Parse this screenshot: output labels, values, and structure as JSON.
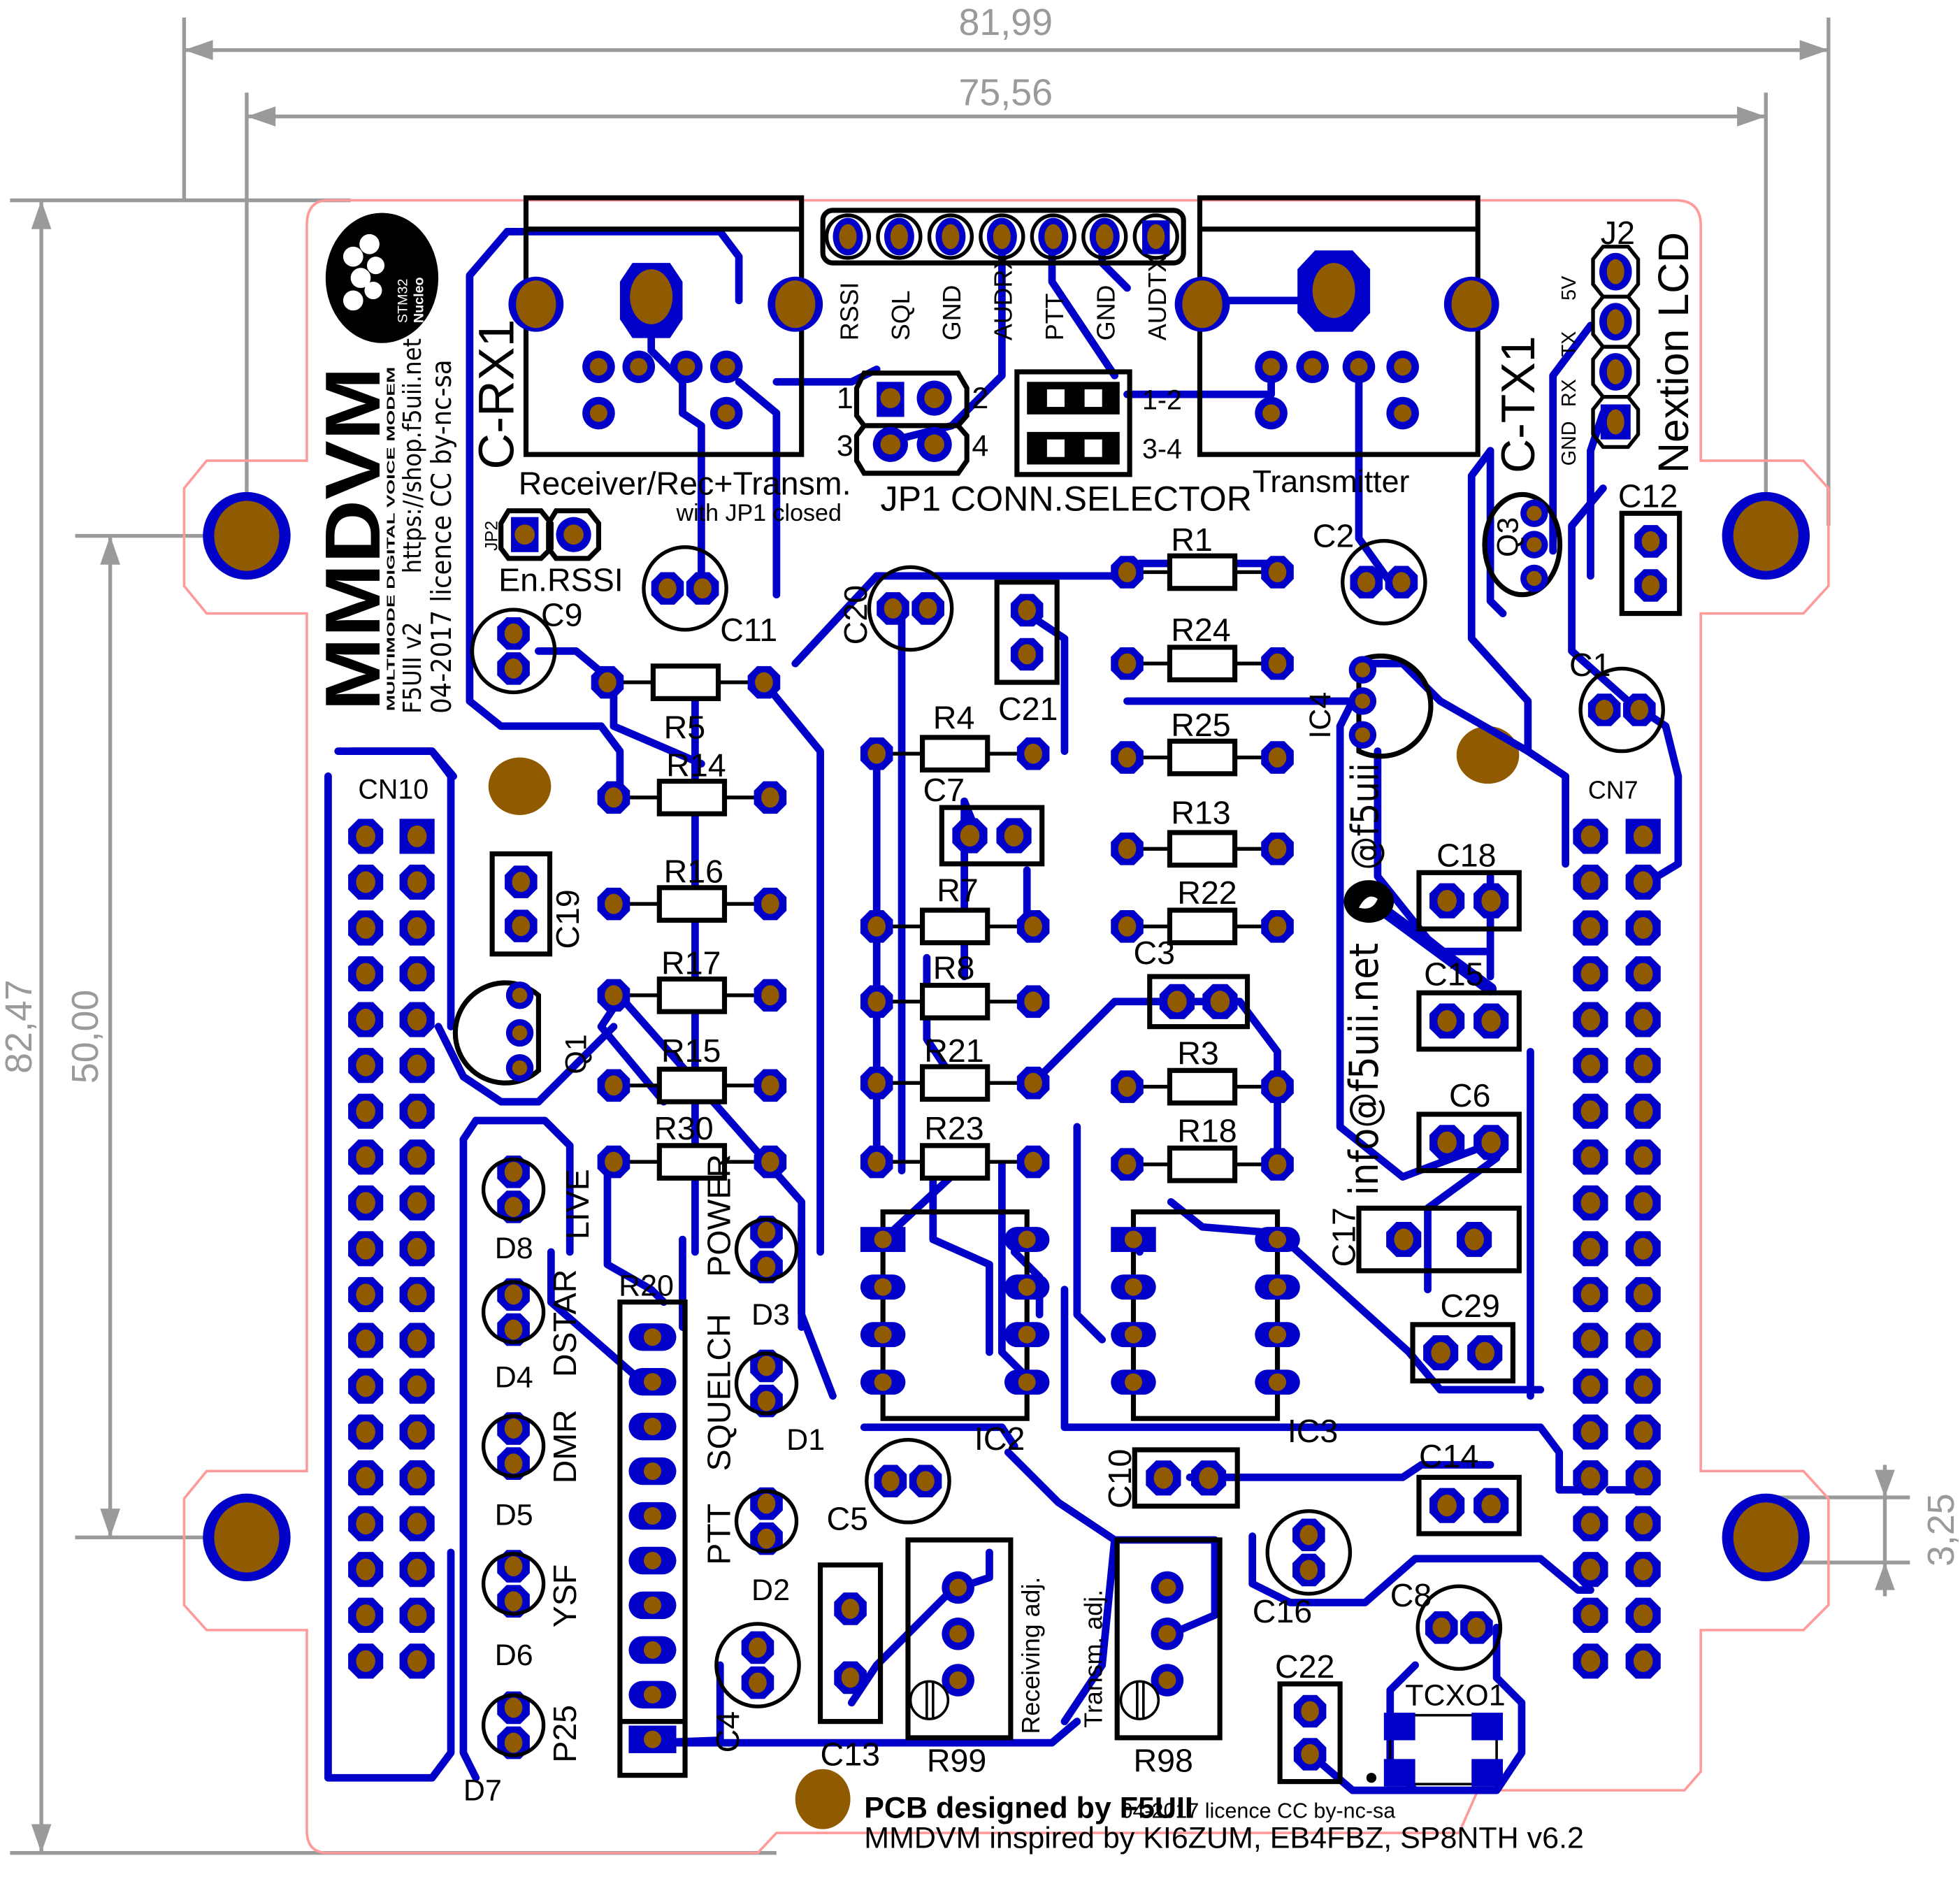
{
  "dimensions": {
    "overall_width": "81,99",
    "inner_width": "75,56",
    "overall_height": "82,47",
    "hole_spacing": "50,00",
    "hole_offset": "3,25"
  },
  "logo": {
    "brand": "MMDVM",
    "tagline": "MULTIMODE DIGITAL VOICE MODEM",
    "version": "F5UII v2",
    "url": "https://shop.f5uii.net",
    "license": "04-2017 licence CC by-nc-sa",
    "nucleo_badge_line1": "STM32",
    "nucleo_badge_line2": "Nucleo"
  },
  "connectors": {
    "crx1": {
      "ref": "C-RX1",
      "label": "Receiver/Rec+Transm.",
      "note": "with JP1 closed"
    },
    "ctx1": {
      "ref": "C-TX1",
      "label": "Transmitter"
    },
    "header_pins": [
      "RSSI",
      "SQL",
      "GND",
      "AUDRX",
      "PTT",
      "GND",
      "AUDTX"
    ],
    "jp1": {
      "label": "JP1 CONN.SELECTOR",
      "pins": [
        "1",
        "2",
        "3",
        "4"
      ],
      "jumpers": [
        "1-2",
        "3-4"
      ]
    },
    "jp2": {
      "ref": "JP2",
      "label": "En.RSSI"
    },
    "j2": {
      "ref": "J2",
      "title": "Nextion LCD",
      "pins": [
        "5V",
        "TX",
        "RX",
        "GND"
      ]
    },
    "cn10": "CN10",
    "cn7": "CN7"
  },
  "components": {
    "resistors": [
      "R1",
      "R24",
      "R25",
      "R13",
      "R22",
      "R3",
      "R18",
      "R4",
      "R7",
      "R8",
      "R21",
      "R23",
      "R5",
      "R14",
      "R16",
      "R17",
      "R15",
      "R30",
      "R20"
    ],
    "capacitors": [
      "C1",
      "C2",
      "C3",
      "C4",
      "C5",
      "C6",
      "C7",
      "C8",
      "C9",
      "C10",
      "C11",
      "C12",
      "C13",
      "C14",
      "C15",
      "C16",
      "C17",
      "C18",
      "C19",
      "C20",
      "C21",
      "C22",
      "C29"
    ],
    "transistors": [
      "Q1",
      "Q3"
    ],
    "ics": [
      "IC2",
      "IC3",
      "IC4"
    ],
    "leds": [
      {
        "ref": "D8",
        "label": "LIVE"
      },
      {
        "ref": "D4",
        "label": "DSTAR"
      },
      {
        "ref": "D5",
        "label": "DMR"
      },
      {
        "ref": "D6",
        "label": "YSF"
      },
      {
        "ref": "D7",
        "label": "P25"
      },
      {
        "ref": "D3",
        "label": "POWER"
      },
      {
        "ref": "D1",
        "label": "SQUELCH"
      },
      {
        "ref": "D2",
        "label": "PTT"
      }
    ],
    "trimmers": [
      {
        "ref": "R99",
        "label": "Receiving adj."
      },
      {
        "ref": "R98",
        "label": "Transm. adj."
      }
    ],
    "tcxo": "TCXO1"
  },
  "contact": "info@f5uii.net",
  "twitter": "@f5uii",
  "footer": {
    "line1_main": "PCB designed by F5UII",
    "line1_small": "04-2017 licence CC by-nc-sa",
    "line2": "MMDVM inspired by KI6ZUM, EB4FBZ, SP8NTH v6.2"
  },
  "colors": {
    "copper": "#0000c8",
    "drill": "#8f5a00",
    "silkscreen": "#000000",
    "board_edge": "#ff9a9a",
    "dimension": "#9a9a9a"
  }
}
